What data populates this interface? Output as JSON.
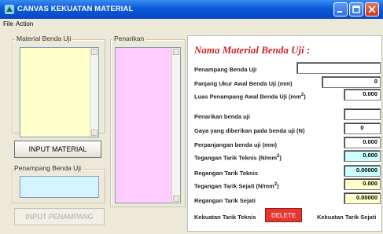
{
  "window": {
    "title": "CANVAS KEKUATAN MATERIAL",
    "minimize_label": "minimize",
    "maximize_label": "maximize",
    "close_label": "close"
  },
  "menu": [
    {
      "label": "File"
    },
    {
      "label": "Action"
    }
  ],
  "left": {
    "material_group_label": "Material Benda Uji",
    "input_material_button": "INPUT MATERIAL",
    "penampang_group_label": "Penampang Benda Uji",
    "input_penampang_button": "INPUT PENAMPANG"
  },
  "middle": {
    "penarikan_group_label": "Penarikan"
  },
  "panel": {
    "title": "Nama Material Benda Uji :",
    "penampang_label": "Penampang Benda Uji",
    "penampang_value": "",
    "panjang_label": "Panjang Ukur Awal Benda Uji (mm)",
    "panjang_value": "0",
    "luas_label": "Luas Penampang Awal Benda Uji (mm",
    "luas_sup": "2",
    "luas_suffix": ")",
    "luas_value": "0.000",
    "penarikan_label": "Penarikan benda uji",
    "penarikan_value": "",
    "gaya_label": "Gaya yang diberikan pada benda uji (N)",
    "gaya_value": "0",
    "perpanjangan_label": "Perpanjangan benda uji (mm)",
    "perpanjangan_value": "0.000",
    "tegangan_teknis_label": "Tegangan Tarik Teknis (N/mm",
    "tegangan_teknis_sup": "2",
    "tegangan_teknis_suffix": ")",
    "tegangan_teknis_value": "0.000",
    "regangan_teknis_label": "Regangan Tarik Teknis",
    "regangan_teknis_value": "0.00000",
    "tegangan_sejati_label": "Tegangan Tarik Sejati (N/mm",
    "tegangan_sejati_sup": "2",
    "tegangan_sejati_suffix": ")",
    "tegangan_sejati_value": "0.000",
    "regangan_sejati_label": "Regangan Tarik Sejati",
    "regangan_sejati_value": "0.00000",
    "kekuatan_teknis_label": "Kekuatan Tarik Teknis",
    "kekuatan_sejati_label": "Kekuatan Tarik Sejati",
    "delete_button": "DELETE"
  },
  "colors": {
    "material_list_bg": "#FFFFCC",
    "penampang_field_bg": "#D5F4FF",
    "penarikan_list_bg": "#FFCCFF",
    "cyan_field": "#CCFFFF",
    "yellow_field": "#FFFFCC",
    "delete_bg": "#E8362F",
    "title_red": "#C9262A"
  }
}
